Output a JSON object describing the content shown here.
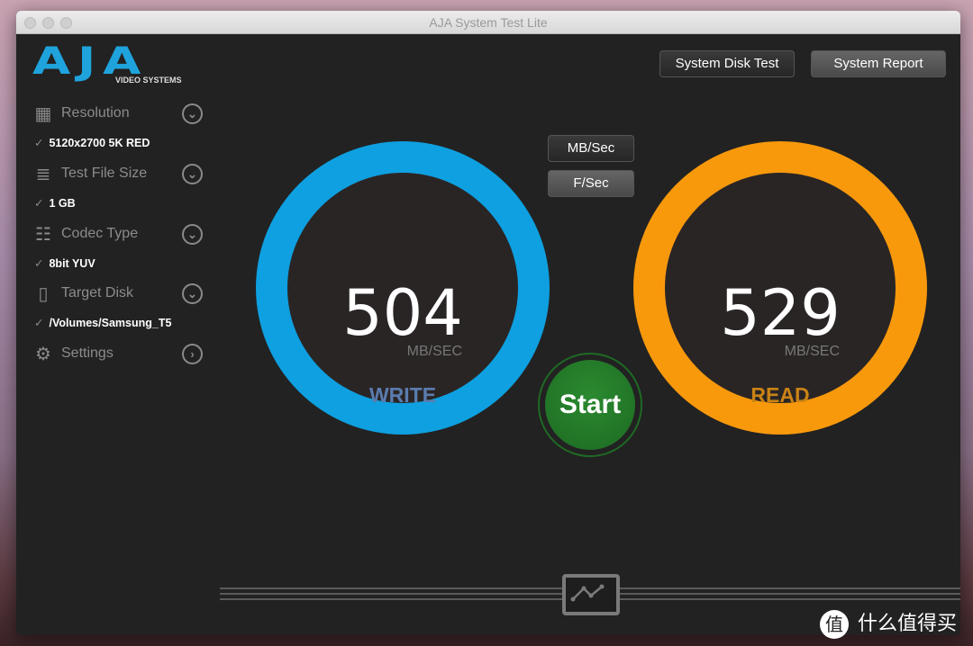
{
  "window": {
    "title": "AJA System Test Lite"
  },
  "logo": {
    "text": "AJA",
    "subtitle": "VIDEO SYSTEMS"
  },
  "toolbar": {
    "system_disk_test": "System Disk Test",
    "system_report": "System Report"
  },
  "sidebar": {
    "items": [
      {
        "label": "Resolution",
        "value": "5120x2700 5K RED",
        "icon": "chip-icon"
      },
      {
        "label": "Test File Size",
        "value": "1 GB",
        "icon": "layers-icon"
      },
      {
        "label": "Codec Type",
        "value": "8bit YUV",
        "icon": "grid-icon"
      },
      {
        "label": "Target Disk",
        "value": "/Volumes/Samsung_T5",
        "icon": "hard-disk-icon"
      },
      {
        "label": "Settings",
        "icon": "gear-icon"
      }
    ],
    "check": "✓"
  },
  "units": {
    "mbsec": "MB/Sec",
    "fsec": "F/Sec",
    "selected": "F/Sec"
  },
  "write": {
    "value": "504",
    "unit": "MB/SEC",
    "label": "WRITE",
    "color": "#0ea0e0"
  },
  "read": {
    "value": "529",
    "unit": "MB/SEC",
    "label": "READ",
    "color": "#f8990c"
  },
  "start": {
    "label": "Start",
    "color": "#1f7a2a"
  },
  "watermark": {
    "badge": "值",
    "text": "什么值得买"
  }
}
